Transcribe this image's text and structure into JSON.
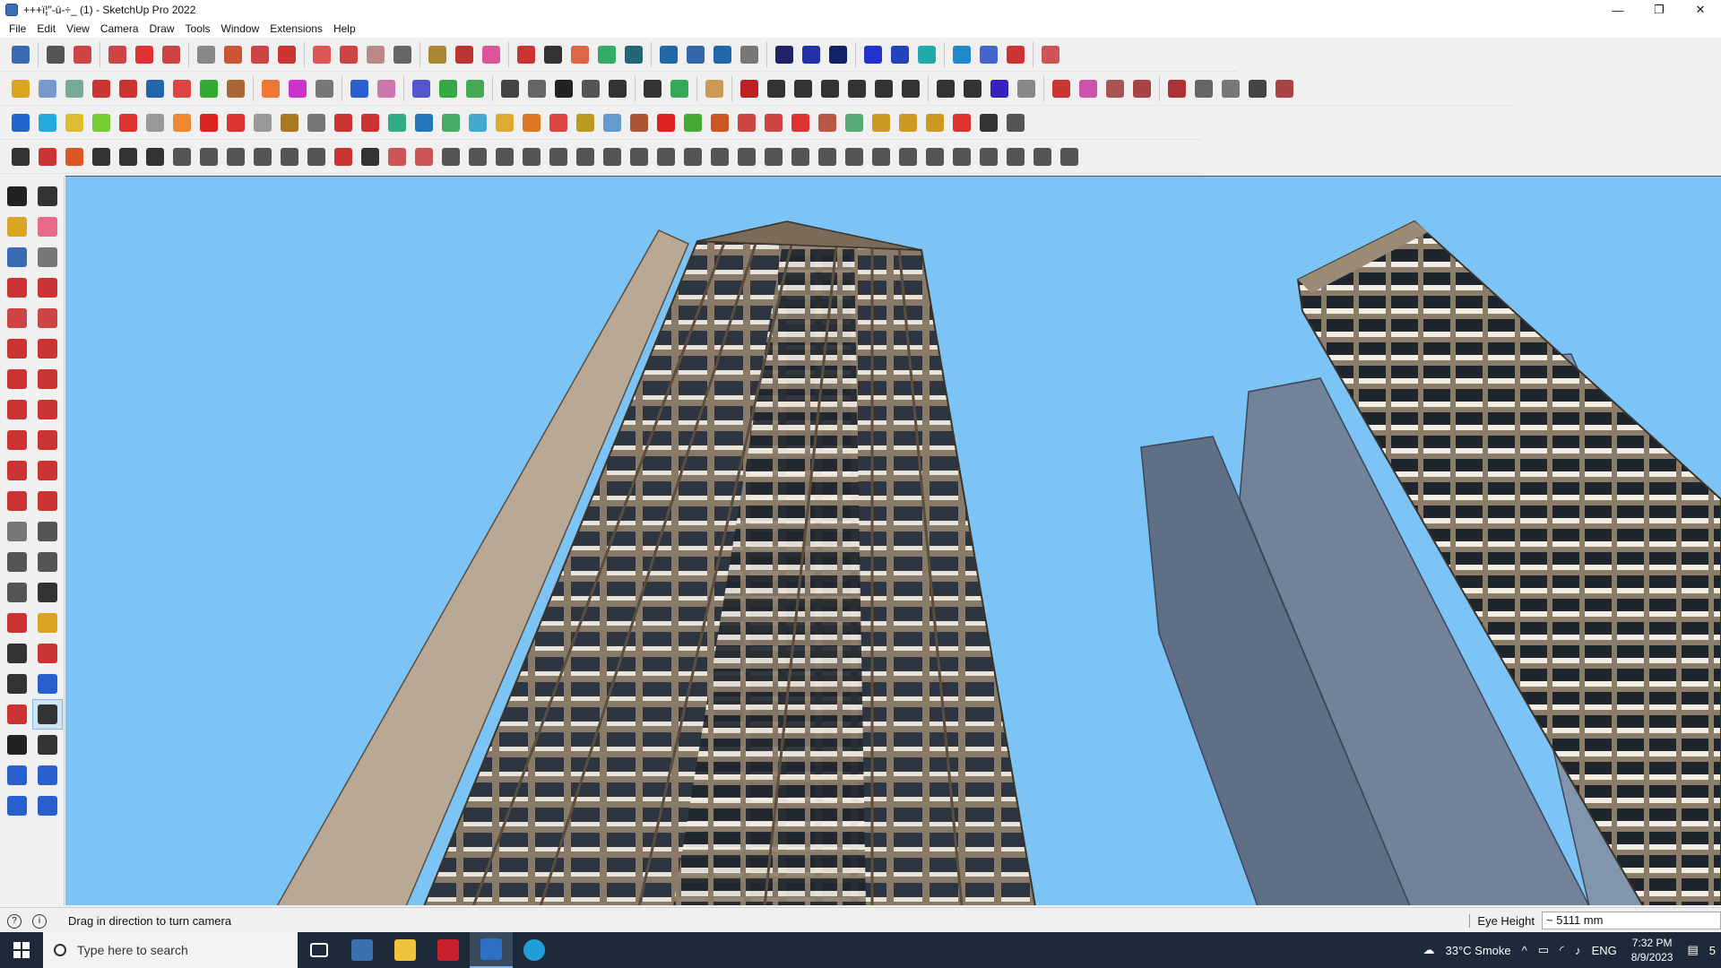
{
  "window": {
    "title": "+++ï¦\"-ú-÷_ (1) - SketchUp Pro 2022",
    "minimize": "—",
    "maximize": "❐",
    "close": "✕"
  },
  "menu": [
    "File",
    "Edit",
    "View",
    "Camera",
    "Draw",
    "Tools",
    "Window",
    "Extensions",
    "Help"
  ],
  "toolbars": {
    "row1_colors": [
      "#3a6ab2",
      "#555",
      "#c44",
      "#c44",
      "#d33",
      "#c44",
      "#888",
      "#c53",
      "#c44",
      "#c33",
      "#d55",
      "#c44",
      "#b88",
      "#666",
      "#a83",
      "#b33",
      "#d59",
      "#c33",
      "#333",
      "#d64",
      "#3a6",
      "#267",
      "#26a",
      "#36a",
      "#26a",
      "#777",
      "#226",
      "#23a",
      "#126",
      "#23c",
      "#24b",
      "#2aa",
      "#28c",
      "#46c",
      "#c33",
      "#c55"
    ],
    "row2_colors": [
      "#d9a520",
      "#7799cc",
      "#7a9",
      "#c33",
      "#c33",
      "#26a",
      "#d44",
      "#3a3",
      "#a63",
      "#e73",
      "#c3c",
      "#777",
      "#2a5fd0",
      "#c7a",
      "#55c",
      "#3a4",
      "#4a5",
      "#444",
      "#666",
      "#222",
      "#555",
      "#333",
      "#333",
      "#3a5",
      "#c95",
      "#b22",
      "#333",
      "#333",
      "#333",
      "#333",
      "#333",
      "#333",
      "#333",
      "#333",
      "#32b",
      "#888",
      "#c33",
      "#c5a",
      "#a55",
      "#a44",
      "#a33",
      "#666",
      "#777",
      "#444",
      "#a44"
    ],
    "row3_colors": [
      "#26c",
      "#2ad",
      "#db3",
      "#7c3",
      "#d33",
      "#999",
      "#e83",
      "#d22",
      "#d33",
      "#999",
      "#a72",
      "#777",
      "#c33",
      "#c33",
      "#3a8",
      "#27b",
      "#4a6",
      "#4ac",
      "#da3",
      "#d72",
      "#d44",
      "#b92",
      "#69c",
      "#a53",
      "#d22",
      "#4a3",
      "#c52",
      "#c44",
      "#c44",
      "#d33",
      "#b54",
      "#5a7",
      "#c92",
      "#c92",
      "#c92",
      "#d33",
      "#333",
      "#555"
    ],
    "row4_colors": [
      "#333",
      "#c33",
      "#d52",
      "#333",
      "#333",
      "#333",
      "#555",
      "#555",
      "#555",
      "#555",
      "#555",
      "#555",
      "#c33",
      "#333",
      "#c55",
      "#c55",
      "#555",
      "#555",
      "#555",
      "#555",
      "#555",
      "#555",
      "#555",
      "#555",
      "#555",
      "#555",
      "#555",
      "#555",
      "#555",
      "#555",
      "#555",
      "#555",
      "#555",
      "#555",
      "#555",
      "#555",
      "#555",
      "#555",
      "#555",
      "#555"
    ]
  },
  "left_tools": [
    "select-icon",
    "orbit-icon",
    "paint-bucket-icon",
    "eraser-icon",
    "component-icon",
    "tape-icon",
    "line-icon",
    "freehand-icon",
    "rectangle-icon",
    "rotated-rect-icon",
    "circle-icon",
    "polygon-icon",
    "arc-icon",
    "arc2-icon",
    "arc3-icon",
    "pie-icon",
    "move-icon",
    "push-pull-icon",
    "rotate-icon",
    "follow-me-icon",
    "scale-icon",
    "offset-icon",
    "tape-measure-icon",
    "dimension-icon",
    "protractor-icon",
    "text-icon",
    "axes-icon",
    "3d-text-icon",
    "orbit-tool-icon",
    "pan-icon",
    "zoom-icon",
    "zoom-window-icon",
    "zoom-extents-icon",
    "previous-view-icon",
    "position-camera-icon",
    "look-around-icon",
    "walk-icon",
    "section-plane-icon",
    "sandbox-icon",
    "layers-icon",
    "outliner-icon",
    "scenes-icon"
  ],
  "status": {
    "text": "Drag in direction to turn camera",
    "vcb_label": "Eye Height",
    "vcb_value": "~ 5111 mm"
  },
  "taskbar": {
    "search_placeholder": "Type here to search",
    "weather": "33°C  Smoke",
    "lang": "ENG",
    "time": "7:32 PM",
    "date": "8/9/2023",
    "notif_count": "5"
  }
}
